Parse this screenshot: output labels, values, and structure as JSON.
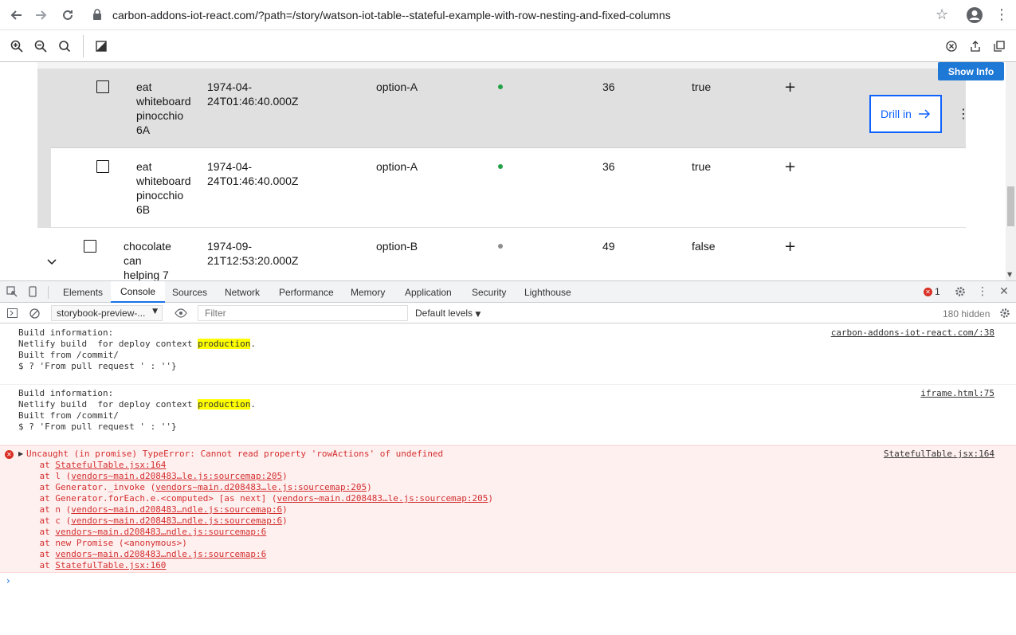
{
  "browser": {
    "url": "carbon-addons-iot-react.com/?path=/story/watson-iot-table--stateful-example-with-row-nesting-and-fixed-columns"
  },
  "icons": {
    "back": "arrow-left-icon",
    "forward": "arrow-right-icon",
    "reload": "reload-icon",
    "star": "star-icon"
  },
  "table": {
    "rows": [
      {
        "name": "eat\nwhiteboard\npinocchio\n6A",
        "date": "1974-04-\n24T01:46:40.000Z",
        "option": "option-A",
        "status_color": "#24a148",
        "number": "36",
        "bool": "true",
        "highlighted": true
      },
      {
        "name": "eat\nwhiteboard\npinocchio\n6B",
        "date": "1974-04-\n24T01:46:40.000Z",
        "option": "option-A",
        "status_color": "#24a148",
        "number": "36",
        "bool": "true",
        "highlighted": false
      },
      {
        "name": "chocolate\ncan\nhelping 7",
        "date": "1974-09-\n21T12:53:20.000Z",
        "option": "option-B",
        "status_color": "#8d8d8d",
        "number": "49",
        "bool": "false",
        "highlighted": false
      }
    ],
    "drill_label": "Drill in",
    "plus_symbol": "+"
  },
  "storybook": {
    "show_info_label": "Show Info"
  },
  "devtools": {
    "tabs": [
      "Elements",
      "Console",
      "Sources",
      "Network",
      "Performance",
      "Memory",
      "Application",
      "Security",
      "Lighthouse"
    ],
    "active_tab": "Console",
    "error_count": "1",
    "context": "storybook-preview-...",
    "filter_placeholder": "Filter",
    "levels": "Default levels",
    "hidden": "180 hidden"
  },
  "console": {
    "messages": [
      {
        "lines": [
          "Build information:",
          "Netlify build  for deploy context ",
          "Built from /commit/",
          "$ ? 'From pull request ' : ''}"
        ],
        "highlight": "production",
        "highlight_suffix": ".",
        "source": "carbon-addons-iot-react.com/:38"
      },
      {
        "lines": [
          "Build information:",
          "Netlify build  for deploy context ",
          "Built from /commit/",
          "$ ? 'From pull request ' : ''}"
        ],
        "highlight": "production",
        "highlight_suffix": ".",
        "source": "iframe.html:75"
      }
    ],
    "error": {
      "header": "Uncaught (in promise) TypeError: Cannot read property 'rowActions' of undefined",
      "source": "StatefulTable.jsx:164",
      "stack": [
        {
          "prefix": "    at ",
          "link": "StatefulTable.jsx:164",
          "suffix": ""
        },
        {
          "prefix": "    at l (",
          "link": "vendors~main.d208483…le.js:sourcemap:205",
          "suffix": ")"
        },
        {
          "prefix": "    at Generator._invoke (",
          "link": "vendors~main.d208483…le.js:sourcemap:205",
          "suffix": ")"
        },
        {
          "prefix": "    at Generator.forEach.e.<computed> [as next] (",
          "link": "vendors~main.d208483…le.js:sourcemap:205",
          "suffix": ")"
        },
        {
          "prefix": "    at n (",
          "link": "vendors~main.d208483…ndle.js:sourcemap:6",
          "suffix": ")"
        },
        {
          "prefix": "    at c (",
          "link": "vendors~main.d208483…ndle.js:sourcemap:6",
          "suffix": ")"
        },
        {
          "prefix": "    at ",
          "link": "vendors~main.d208483…ndle.js:sourcemap:6",
          "suffix": ""
        },
        {
          "prefix": "    at new Promise (<anonymous>)",
          "link": "",
          "suffix": ""
        },
        {
          "prefix": "    at ",
          "link": "vendors~main.d208483…ndle.js:sourcemap:6",
          "suffix": ""
        },
        {
          "prefix": "    at ",
          "link": "StatefulTable.jsx:160",
          "suffix": ""
        }
      ]
    }
  }
}
